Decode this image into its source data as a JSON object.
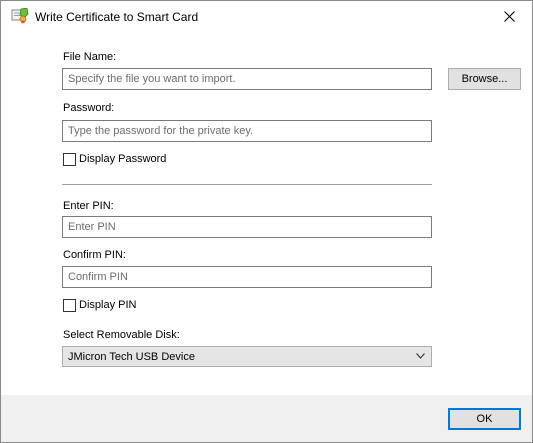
{
  "window": {
    "title": "Write Certificate to Smart Card",
    "icons": {
      "app": "certificate-icon",
      "close": "close-icon"
    }
  },
  "file_name": {
    "label": "File Name:",
    "value": "",
    "placeholder": "Specify the file you want to import.",
    "browse_label": "Browse..."
  },
  "password": {
    "label": "Password:",
    "value": "",
    "placeholder": "Type the password for the private key.",
    "display_label": "Display Password",
    "display_checked": false
  },
  "enter_pin": {
    "label": "Enter PIN:",
    "value": "",
    "placeholder": "Enter PIN"
  },
  "confirm_pin": {
    "label": "Confirm PIN:",
    "value": "",
    "placeholder": "Confirm PIN",
    "display_label": "Display PIN",
    "display_checked": false
  },
  "disk": {
    "label": "Select Removable Disk:",
    "selected": "JMicron Tech USB Device",
    "icon": "chevron-down-icon"
  },
  "footer": {
    "ok_label": "OK"
  },
  "colors": {
    "accent": "#0078d7",
    "footer_bg": "#f0f0f0",
    "button_bg": "#e1e1e1"
  }
}
